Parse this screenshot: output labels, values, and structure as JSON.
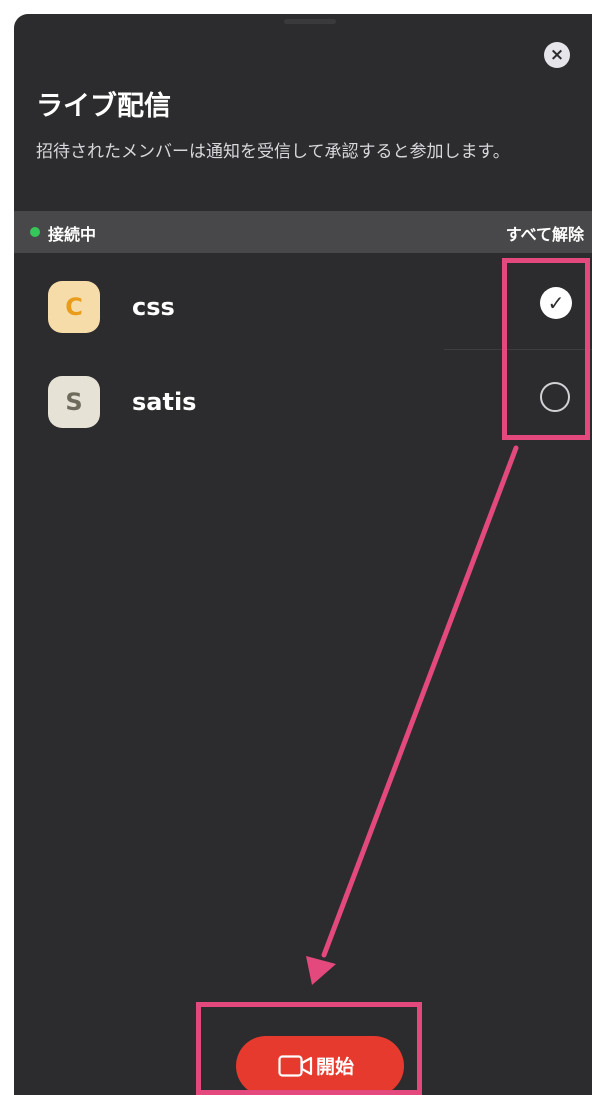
{
  "sheet": {
    "title": "ライブ配信",
    "description": "招待されたメンバーは通知を受信して承認すると参加します。",
    "close_icon": "close-icon"
  },
  "section": {
    "status_label": "接続中",
    "status_color": "#34c759",
    "deselect_all_label": "すべて解除"
  },
  "members": [
    {
      "initial": "C",
      "name": "css",
      "selected": true,
      "avatar_color": "#f6dca9"
    },
    {
      "initial": "S",
      "name": "satis",
      "selected": false,
      "avatar_color": "#e7e2d6"
    }
  ],
  "check_glyph": "✓",
  "start_button": {
    "label": "開始",
    "icon": "video-camera-icon",
    "color": "#e63a2e"
  },
  "annotation": {
    "highlight_color": "#e4497d"
  }
}
